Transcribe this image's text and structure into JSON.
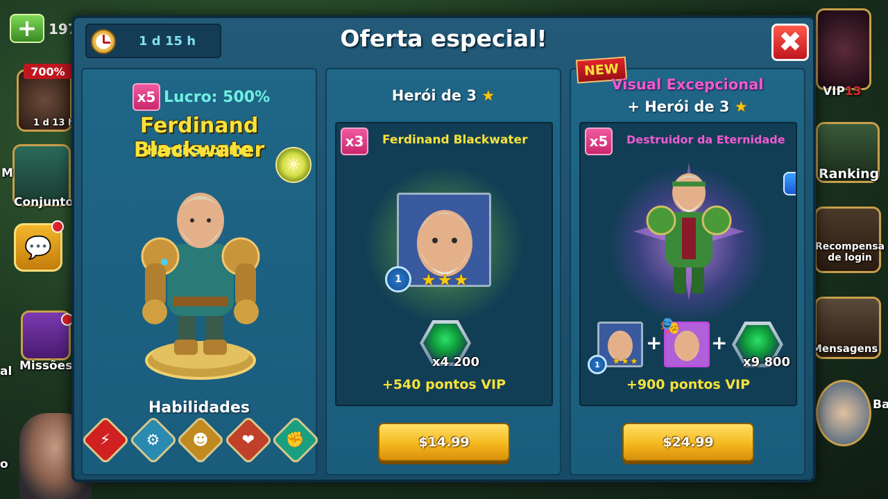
{
  "background": {
    "resource_count": "197",
    "percent_badge": "700%",
    "timer_small": "1 d 13 h",
    "left_labels": [
      "Conjuntos",
      "Missões",
      "M",
      "al",
      "o"
    ],
    "right_labels": [
      "VIP",
      "Ranking",
      "Recompensa de login",
      "Mensagens",
      "Ba"
    ],
    "vip_level": "13"
  },
  "modal": {
    "title": "Oferta especial!",
    "timer": "1 d 15 h",
    "close_symbol": "✖"
  },
  "hero_panel": {
    "multiplier": "x5",
    "profit": "Lucro: 500%",
    "hero_name": "Ferdinand Blackwater",
    "hero_rank": "Herói Sublime",
    "skills_title": "Habilidades",
    "skills": [
      {
        "icon": "lightning-icon",
        "symbol": "⚡",
        "color": "#d02020"
      },
      {
        "icon": "gear-icon",
        "symbol": "⚙",
        "color": "#2a8ab0"
      },
      {
        "icon": "beast-icon",
        "symbol": "☻",
        "color": "#c08a20"
      },
      {
        "icon": "heart-icon",
        "symbol": "❤",
        "color": "#c0402a"
      },
      {
        "icon": "fist-icon",
        "symbol": "✊",
        "color": "#1aa080"
      }
    ]
  },
  "offer1": {
    "heading": "Herói de 3",
    "multiplier": "x3",
    "item_name": "Ferdinand Blackwater",
    "level": "1",
    "stars": "★★★",
    "gems_qty": "x4 200",
    "vip_points": "+540 pontos VIP",
    "price": "$14.99"
  },
  "offer2": {
    "new_label": "NEW",
    "title_line1": "Visual Excepcional",
    "title_line2": "+ Herói de 3",
    "multiplier": "x5",
    "item_name": "Destruidor da Eternidade",
    "info_label": "i",
    "hero_level": "1",
    "hero_stars": "★★★",
    "gems_qty": "x9 800",
    "vip_points": "+900 pontos VIP",
    "price": "$24.99"
  },
  "colors": {
    "accent_yellow": "#f8e23b",
    "accent_pink": "#f05ad0",
    "panel_blue": "#1f6687",
    "button_gold": "#f4b81e"
  }
}
